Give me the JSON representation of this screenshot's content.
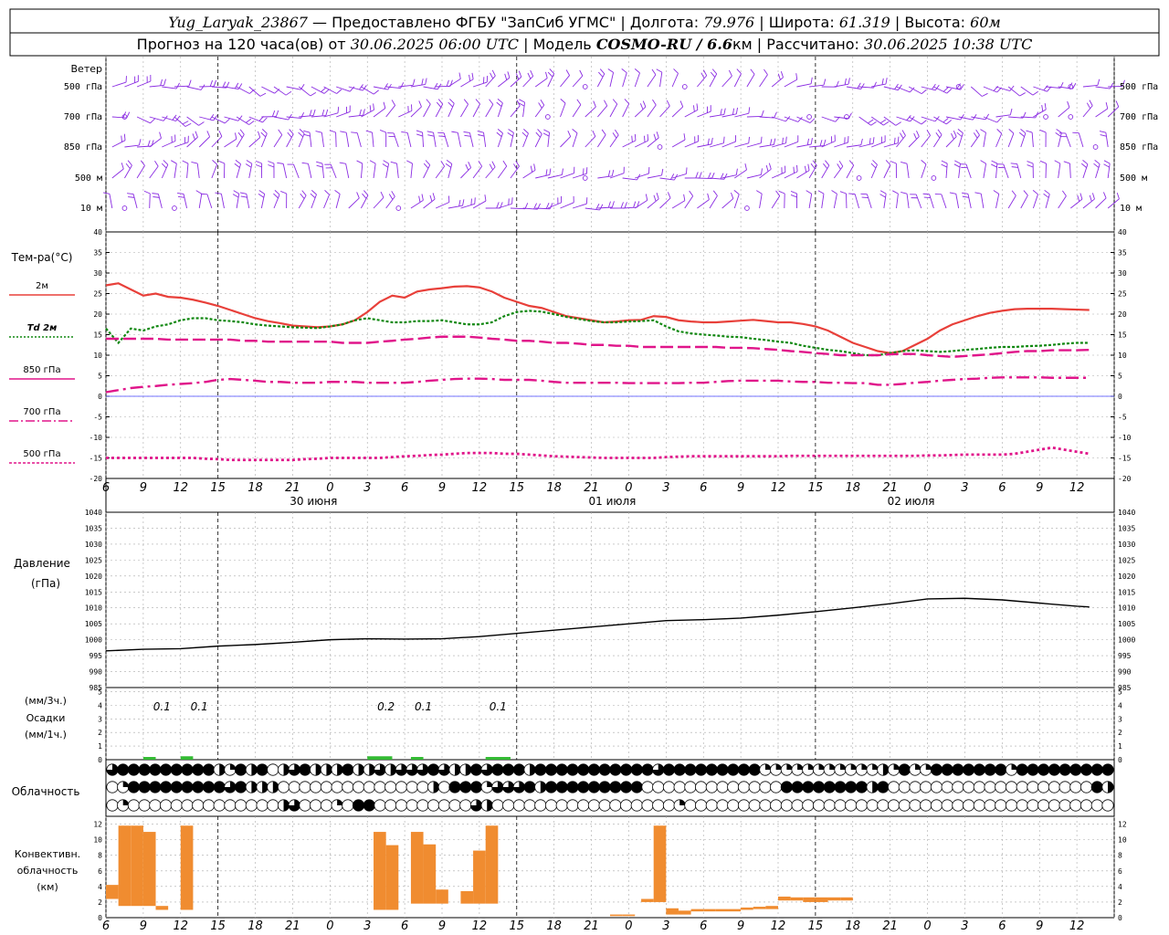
{
  "header": {
    "station": "Yug_Laryak_23867",
    "provider": " — Предоставлено ФГБУ \"ЗапСиб УГМС\" | Долгота: ",
    "lon": "79.976",
    "lat_label": " | Широта: ",
    "lat": "61.319",
    "alt_label": " | Высота: ",
    "alt": "60м",
    "forecast_pre": "Прогноз на 120 часа(ов) от ",
    "forecast_date": "30.06.2025 06:00 UTC",
    "model_label": "  | Модель ",
    "model": "COSMO-RU / 6.6",
    "model_unit": "км",
    "calc_label": " | Рассчитано: ",
    "calc_date": "30.06.2025 10:38 UTC"
  },
  "labels": {
    "wind": "Ветер",
    "wind_levels": [
      "500 гПа",
      "700 гПа",
      "850 гПа",
      "500 м",
      "10  м"
    ],
    "temp_title": "Тем-ра(°С)",
    "temp_series": [
      "2м",
      "Td  2м",
      "850 гПа",
      "700 гПа",
      "500 гПа"
    ],
    "pressure_title": "Давление",
    "pressure_unit": "(гПа)",
    "precip_3h": "(мм/3ч.)",
    "precip_title": "Осадки",
    "precip_1h": "(мм/1ч.)",
    "cloud": "Облачность",
    "conv1": "Конвективн.",
    "conv2": "облачность",
    "conv3": "(км)",
    "days": [
      "30 июня",
      "01 июля",
      "02 июля"
    ]
  },
  "colors": {
    "t2m": "#e8403a",
    "td": "#118811",
    "t850": "#e0158a",
    "wind": "#8a2be2",
    "conv": "#f08c30",
    "precip": "#33bb33",
    "zero": "#4444ff"
  },
  "chart_data": [
    {
      "type": "line",
      "name": "temperature",
      "x_hours": [
        0,
        2,
        4,
        6,
        8,
        10,
        12,
        14,
        16,
        18,
        20,
        22,
        24,
        26,
        28,
        30,
        32,
        34,
        36,
        38,
        40,
        42,
        44,
        46,
        48,
        50,
        52,
        54,
        56,
        58,
        60,
        62,
        64,
        66,
        68,
        70,
        72,
        74,
        76,
        78,
        80,
        82,
        84,
        86,
        88,
        90,
        92,
        94,
        96,
        98,
        100,
        102,
        104,
        106,
        108,
        110,
        112,
        114,
        116,
        118,
        120,
        122,
        124,
        126,
        128,
        130,
        132,
        134,
        136,
        138,
        140,
        142,
        144,
        146,
        148,
        150,
        152,
        154,
        156,
        158
      ],
      "ylim": [
        -20,
        40
      ],
      "yticks": [
        -20,
        -15,
        -10,
        -5,
        0,
        5,
        10,
        15,
        20,
        25,
        30,
        35,
        40
      ],
      "series": [
        {
          "name": "2м",
          "values": [
            27,
            27.5,
            26,
            24.5,
            25,
            24.2,
            24,
            23.5,
            22.8,
            22,
            21,
            20,
            19,
            18.3,
            17.8,
            17.2,
            17,
            16.8,
            17,
            17.5,
            18.5,
            20.5,
            23,
            24.5,
            24,
            25.5,
            26,
            26.3,
            26.7,
            26.8,
            26.5,
            25.5,
            24,
            23,
            22,
            21.5,
            20.5,
            19.5,
            19,
            18.5,
            18,
            18.2,
            18.5,
            18.6,
            19.5,
            19.3,
            18.5,
            18.2,
            18,
            18,
            18.2,
            18.4,
            18.6,
            18.3,
            18,
            18,
            17.6,
            17,
            16,
            14.5,
            13,
            12,
            11,
            10.5,
            11,
            12.5,
            14,
            16,
            17.5,
            18.5,
            19.5,
            20.3,
            20.8,
            21.2,
            21.3,
            21.3,
            21.3,
            21.2,
            21.1,
            21
          ]
        },
        {
          "name": "Td  2м",
          "values": [
            16.5,
            13,
            16.5,
            16,
            17,
            17.5,
            18.5,
            19,
            19,
            18.5,
            18.3,
            18,
            17.5,
            17.2,
            17,
            16.8,
            16.7,
            16.6,
            17,
            17.5,
            18.5,
            19,
            18.5,
            18,
            18,
            18.3,
            18.3,
            18.5,
            18,
            17.5,
            17.5,
            18,
            19.5,
            20.5,
            20.8,
            20.6,
            20,
            19.3,
            18.8,
            18.3,
            18,
            18,
            18.2,
            18.3,
            18.5,
            17,
            15.8,
            15.3,
            15,
            14.8,
            14.5,
            14.4,
            14,
            13.7,
            13.3,
            13,
            12.3,
            11.8,
            11.3,
            11,
            10.5,
            10,
            10,
            10.5,
            11,
            11.2,
            11,
            10.8,
            11,
            11.3,
            11.5,
            11.8,
            12,
            12,
            12.2,
            12.3,
            12.5,
            12.8,
            13,
            13
          ]
        },
        {
          "name": "850 гПа",
          "values": [
            14,
            14,
            14,
            14,
            14,
            13.8,
            13.8,
            13.8,
            13.8,
            13.8,
            13.8,
            13.5,
            13.5,
            13.3,
            13.3,
            13.3,
            13.3,
            13.3,
            13.3,
            13,
            13,
            13,
            13.3,
            13.5,
            13.8,
            14,
            14.3,
            14.5,
            14.5,
            14.5,
            14.3,
            14,
            13.8,
            13.5,
            13.5,
            13.3,
            13,
            13,
            12.8,
            12.5,
            12.5,
            12.3,
            12.3,
            12,
            12,
            12,
            12,
            12,
            12,
            12,
            11.8,
            11.8,
            11.7,
            11.5,
            11.3,
            11,
            10.8,
            10.5,
            10.3,
            10,
            10,
            10,
            10,
            10.2,
            10.3,
            10.3,
            10,
            9.8,
            9.6,
            9.8,
            10,
            10.2,
            10.5,
            10.8,
            11,
            11,
            11.2,
            11.2,
            11.2,
            11.3
          ]
        },
        {
          "name": "700 гПа",
          "values": [
            1,
            1.5,
            2,
            2.3,
            2.5,
            2.8,
            3,
            3.2,
            3.5,
            4,
            4.2,
            4,
            3.8,
            3.5,
            3.5,
            3.3,
            3.3,
            3.3,
            3.5,
            3.5,
            3.5,
            3.3,
            3.3,
            3.3,
            3.3,
            3.5,
            3.8,
            4,
            4.2,
            4.3,
            4.3,
            4.2,
            4,
            4,
            4,
            3.8,
            3.5,
            3.3,
            3.3,
            3.3,
            3.3,
            3.3,
            3.2,
            3.2,
            3.2,
            3.2,
            3.2,
            3.3,
            3.3,
            3.5,
            3.7,
            3.8,
            3.8,
            3.8,
            3.8,
            3.6,
            3.5,
            3.5,
            3.3,
            3.3,
            3.2,
            3.2,
            2.8,
            2.8,
            3,
            3.3,
            3.5,
            3.8,
            4,
            4.2,
            4.3,
            4.5,
            4.6,
            4.6,
            4.6,
            4.6,
            4.5,
            4.5,
            4.5,
            4.5
          ]
        },
        {
          "name": "500 гПа",
          "values": [
            -15,
            -15,
            -15,
            -15,
            -15,
            -15,
            -15,
            -15,
            -15.2,
            -15.3,
            -15.5,
            -15.5,
            -15.5,
            -15.5,
            -15.5,
            -15.5,
            -15.3,
            -15.2,
            -15,
            -15,
            -15,
            -15,
            -15,
            -14.8,
            -14.6,
            -14.5,
            -14.3,
            -14.2,
            -14,
            -13.8,
            -13.8,
            -13.8,
            -14,
            -14,
            -14.2,
            -14.4,
            -14.6,
            -14.7,
            -14.8,
            -14.9,
            -15,
            -15,
            -15,
            -15,
            -15,
            -14.8,
            -14.7,
            -14.6,
            -14.6,
            -14.6,
            -14.6,
            -14.6,
            -14.6,
            -14.6,
            -14.6,
            -14.5,
            -14.5,
            -14.5,
            -14.5,
            -14.5,
            -14.5,
            -14.5,
            -14.5,
            -14.5,
            -14.5,
            -14.5,
            -14.4,
            -14.4,
            -14.3,
            -14.2,
            -14.2,
            -14.2,
            -14.2,
            -14,
            -13.5,
            -13,
            -12.5,
            -13,
            -13.5,
            -14
          ]
        }
      ]
    },
    {
      "type": "line",
      "name": "pressure",
      "ylim": [
        985,
        1040
      ],
      "yticks": [
        985,
        990,
        995,
        1000,
        1005,
        1010,
        1015,
        1020,
        1025,
        1030,
        1035,
        1040
      ],
      "x_hours": [
        0,
        6,
        12,
        18,
        24,
        30,
        36,
        42,
        48,
        54,
        60,
        66,
        72,
        78,
        84,
        90,
        96,
        102,
        108,
        114,
        120,
        126,
        132,
        138,
        144,
        150,
        156,
        158
      ],
      "values": [
        996.5,
        997,
        997.2,
        998,
        998.5,
        999.2,
        1000,
        1000.3,
        1000.2,
        1000.3,
        1001,
        1002,
        1003,
        1004,
        1005,
        1006,
        1006.3,
        1006.8,
        1007.7,
        1008.8,
        1010,
        1011.3,
        1012.8,
        1013,
        1012.5,
        1011.5,
        1010.5,
        1010.3
      ]
    },
    {
      "type": "bar",
      "name": "precipitation",
      "ylim": [
        0,
        5
      ],
      "yticks": [
        0,
        1,
        2,
        3,
        4,
        5
      ],
      "labels_3h": [
        {
          "hour": 9,
          "value": "0.1"
        },
        {
          "hour": 15,
          "value": "0.1"
        },
        {
          "hour": 45,
          "value": "0.2"
        },
        {
          "hour": 51,
          "value": "0.1"
        },
        {
          "hour": 63,
          "value": "0.1"
        }
      ],
      "bars": [
        {
          "h0": 6,
          "h1": 8,
          "v": 0.1
        },
        {
          "h0": 12,
          "h1": 14,
          "v": 0.15
        },
        {
          "h0": 42,
          "h1": 46,
          "v": 0.15
        },
        {
          "h0": 49,
          "h1": 51,
          "v": 0.1
        },
        {
          "h0": 61,
          "h1": 65,
          "v": 0.1
        }
      ]
    },
    {
      "type": "bar",
      "name": "convective",
      "ylim": [
        0,
        13
      ],
      "yticks": [
        0,
        2,
        4,
        6,
        8,
        10,
        12
      ],
      "bars": [
        {
          "h": 1,
          "b": 2.4,
          "t": 4.2
        },
        {
          "h": 3,
          "b": 1.5,
          "t": 11.8
        },
        {
          "h": 5,
          "b": 1.5,
          "t": 11.8
        },
        {
          "h": 7,
          "b": 1.5,
          "t": 11
        },
        {
          "h": 9,
          "b": 1,
          "t": 1.5
        },
        {
          "h": 13,
          "b": 1,
          "t": 11.8
        },
        {
          "h": 44,
          "b": 1,
          "t": 11
        },
        {
          "h": 46,
          "b": 1,
          "t": 9.3
        },
        {
          "h": 50,
          "b": 1.8,
          "t": 11
        },
        {
          "h": 52,
          "b": 1.8,
          "t": 9.4
        },
        {
          "h": 54,
          "b": 1.8,
          "t": 3.6
        },
        {
          "h": 58,
          "b": 1.8,
          "t": 3.4
        },
        {
          "h": 60,
          "b": 1.8,
          "t": 8.6
        },
        {
          "h": 62,
          "b": 1.8,
          "t": 11.8
        },
        {
          "h": 82,
          "b": 0.2,
          "t": 0.4
        },
        {
          "h": 84,
          "b": 0.2,
          "t": 0.4
        },
        {
          "h": 87,
          "b": 2,
          "t": 2.4
        },
        {
          "h": 89,
          "b": 2,
          "t": 11.8
        },
        {
          "h": 91,
          "b": 0.4,
          "t": 1.2
        },
        {
          "h": 93,
          "b": 0.4,
          "t": 0.9
        },
        {
          "h": 95,
          "b": 0.8,
          "t": 1.1
        },
        {
          "h": 97,
          "b": 0.8,
          "t": 1.1
        },
        {
          "h": 99,
          "b": 0.8,
          "t": 1.1
        },
        {
          "h": 101,
          "b": 0.8,
          "t": 1.1
        },
        {
          "h": 103,
          "b": 1,
          "t": 1.3
        },
        {
          "h": 105,
          "b": 1.1,
          "t": 1.4
        },
        {
          "h": 107,
          "b": 1.1,
          "t": 1.5
        },
        {
          "h": 109,
          "b": 2.2,
          "t": 2.7
        },
        {
          "h": 111,
          "b": 2.2,
          "t": 2.6
        },
        {
          "h": 113,
          "b": 2,
          "t": 2.6
        },
        {
          "h": 115,
          "b": 2,
          "t": 2.6
        },
        {
          "h": 117,
          "b": 2.2,
          "t": 2.6
        },
        {
          "h": 119,
          "b": 2.2,
          "t": 2.6
        }
      ]
    },
    {
      "type": "table",
      "name": "cloudiness",
      "levels": 3,
      "codes": "0=clear,1=quarter,2=half,3=three-quarter,4=overcast",
      "rows": [
        "3444444444214240234222422323334322434442444444444443444444444111111111112141144444441444444444",
        "0144444444434222000000000000002044413334244444444400000000000004444444424000000000000000000042",
        "0100000000000000230001044000000000320000000000000000010000000000000000000000000000000000000000"
      ]
    },
    {
      "type": "table",
      "name": "wind",
      "levels": [
        "500 гПа",
        "700 гПа",
        "850 гПа",
        "500 м",
        "10  м"
      ]
    }
  ],
  "axis": {
    "hour_labels": [
      "6",
      "9",
      "12",
      "15",
      "18",
      "21",
      "0",
      "3",
      "6",
      "9",
      "12",
      "15",
      "18",
      "21",
      "0",
      "3",
      "6",
      "9",
      "12",
      "15",
      "18",
      "21",
      "0",
      "3",
      "6",
      "9",
      "12"
    ]
  }
}
